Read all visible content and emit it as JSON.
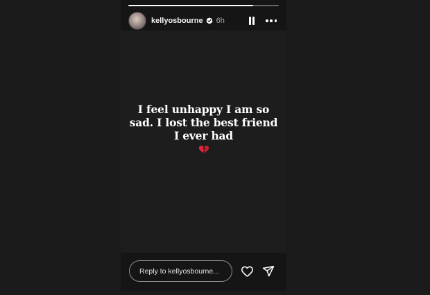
{
  "story": {
    "progress_fraction": 0.83,
    "username": "kellyosbourne",
    "verified": true,
    "time_ago": "6h",
    "message_lines": [
      "I feel unhappy I am so",
      "sad. I lost the best friend",
      "I ever had"
    ],
    "emoji": "broken-heart"
  },
  "reply": {
    "placeholder": "Reply to kellyosbourne..."
  },
  "icons": {
    "pause": "pause-icon",
    "more": "more-options-icon",
    "like": "heart-icon",
    "share": "send-icon"
  },
  "colors": {
    "background": "#1b1b1b",
    "story_bg": "#1d1d1d",
    "text": "#ffffff",
    "muted_text": "#a8a8a8",
    "verified_badge": "#ffffff",
    "broken_heart": "#e0243a"
  }
}
